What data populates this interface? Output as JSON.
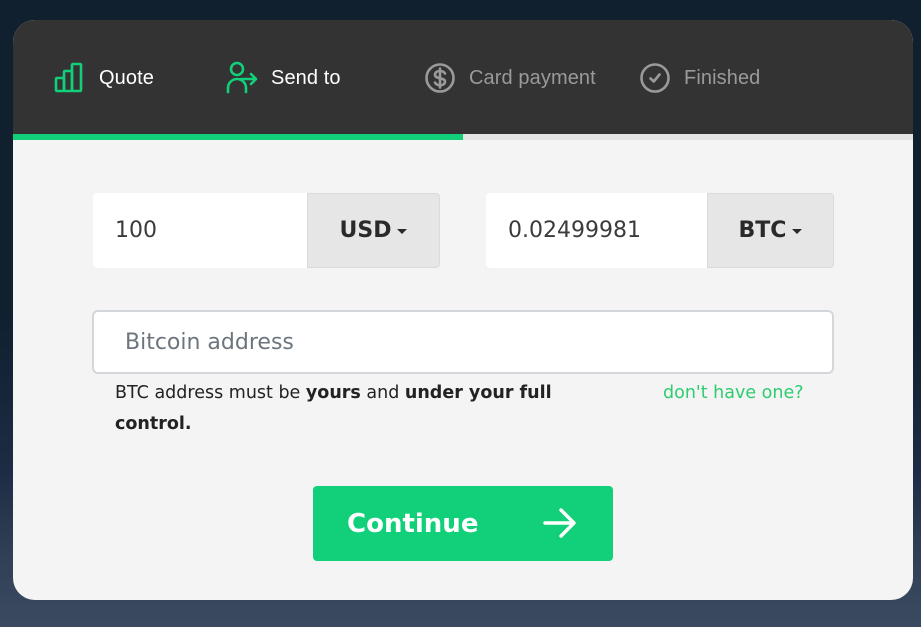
{
  "steps": [
    {
      "label": "Quote",
      "icon": "bar-chart-icon",
      "state": "active"
    },
    {
      "label": "Send to",
      "icon": "user-send-icon",
      "state": "active"
    },
    {
      "label": "Card payment",
      "icon": "dollar-circle-icon",
      "state": "inactive"
    },
    {
      "label": "Finished",
      "icon": "check-circle-icon",
      "state": "inactive"
    }
  ],
  "progress": {
    "percent": 50
  },
  "quote": {
    "fiat_amount": "100",
    "fiat_currency": "USD",
    "crypto_amount": "0.02499981",
    "crypto_currency": "BTC"
  },
  "address": {
    "placeholder": "Bitcoin address",
    "value": ""
  },
  "hint": {
    "part1": "BTC address must be ",
    "bold1": "yours",
    "part2": " and ",
    "bold2": "under your full control."
  },
  "no_wallet_link": "don't have one?",
  "continue_label": "Continue",
  "colors": {
    "accent": "#12d07a",
    "header_bg": "#333333",
    "inactive_text": "#9a9a9a"
  }
}
